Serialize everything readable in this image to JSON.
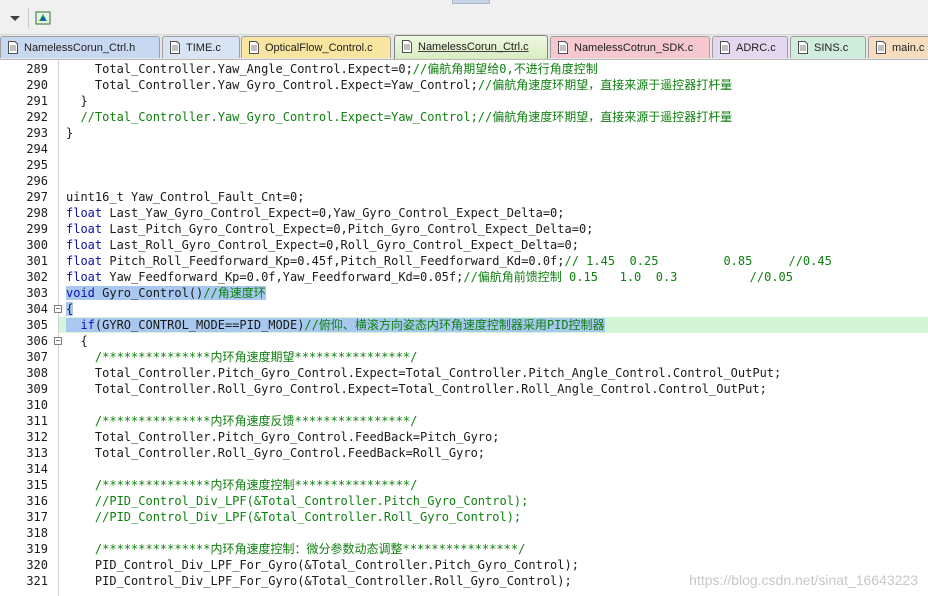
{
  "colors": {
    "keyword": "#1010b0",
    "comment": "#108010",
    "selection": "#a8c8f0",
    "current_line": "#d4f5d8",
    "text": "#1a1a1a"
  },
  "toolbar": {
    "icons": [
      "dropdown-icon",
      "build-icon"
    ]
  },
  "tabs": [
    {
      "label": "NamelessCorun_Ctrl.h",
      "color": "#c8d8f0",
      "active": false
    },
    {
      "label": "TIME.c",
      "color": "#d8e4f4",
      "active": false
    },
    {
      "label": "OpticalFlow_Control.c",
      "color": "#f8e6a0",
      "active": false
    },
    {
      "label": "NamelessCorun_Ctrl.c",
      "color": "#d8ecc0",
      "active": true
    },
    {
      "label": "NamelessCotrun_SDK.c",
      "color": "#f6c8d0",
      "active": false
    },
    {
      "label": "ADRC.c",
      "color": "#e4d8f0",
      "active": false
    },
    {
      "label": "SINS.c",
      "color": "#d0ecdc",
      "active": false
    },
    {
      "label": "main.c",
      "color": "#f8dcc0",
      "active": false
    }
  ],
  "editor": {
    "lines": [
      {
        "num": "289",
        "indent": "    ",
        "text": "Total_Controller.Yaw_Angle_Control.Expect=0;",
        "comment": "//偏航角期望给0,不进行角度控制"
      },
      {
        "num": "290",
        "indent": "    ",
        "text": "Total_Controller.Yaw_Gyro_Control.Expect=Yaw_Control;",
        "comment": "//偏航角速度环期望，直接来源于遥控器打杆量"
      },
      {
        "num": "291",
        "indent": "  ",
        "text": "}",
        "comment": ""
      },
      {
        "num": "292",
        "indent": "  ",
        "text": "",
        "comment": "//Total_Controller.Yaw_Gyro_Control.Expect=Yaw_Control;//偏航角速度环期望，直接来源于遥控器打杆量"
      },
      {
        "num": "293",
        "indent": "",
        "text": "}",
        "comment": ""
      },
      {
        "num": "294",
        "indent": "",
        "text": "",
        "comment": ""
      },
      {
        "num": "295",
        "indent": "",
        "text": "",
        "comment": ""
      },
      {
        "num": "296",
        "indent": "",
        "text": "",
        "comment": ""
      },
      {
        "num": "297",
        "indent": "",
        "text": "uint16_t Yaw_Control_Fault_Cnt=0;",
        "comment": ""
      },
      {
        "num": "298",
        "indent": "",
        "kw": "float",
        "text": " Last_Yaw_Gyro_Control_Expect=0,Yaw_Gyro_Control_Expect_Delta=0;",
        "comment": ""
      },
      {
        "num": "299",
        "indent": "",
        "kw": "float",
        "text": " Last_Pitch_Gyro_Control_Expect=0,Pitch_Gyro_Control_Expect_Delta=0;",
        "comment": ""
      },
      {
        "num": "300",
        "indent": "",
        "kw": "float",
        "text": " Last_Roll_Gyro_Control_Expect=0,Roll_Gyro_Control_Expect_Delta=0;",
        "comment": ""
      },
      {
        "num": "301",
        "indent": "",
        "kw": "float",
        "text": " Pitch_Roll_Feedforward_Kp=0.45f,Pitch_Roll_Feedforward_Kd=0.0f;",
        "comment": "// 1.45  0.25         0.85     //0.45"
      },
      {
        "num": "302",
        "indent": "",
        "kw": "float",
        "text": " Yaw_Feedforward_Kp=0.0f,Yaw_Feedforward_Kd=0.05f;",
        "comment": "//偏航角前馈控制 0.15   1.0  0.3          //0.05"
      },
      {
        "num": "303",
        "indent": "",
        "kw": "void",
        "text": " Gyro_Control()",
        "comment": "//角速度环",
        "selected": true
      },
      {
        "num": "304",
        "indent": "",
        "text": "{",
        "comment": "",
        "selected": true,
        "fold": true
      },
      {
        "num": "305",
        "indent": "  ",
        "kw": "if",
        "text": "(GYRO_CONTROL_MODE==PID_MODE)",
        "comment": "//俯仰、横滚方向姿态内环角速度控制器采用PID控制器",
        "selected": true,
        "current": true
      },
      {
        "num": "306",
        "indent": "  ",
        "text": "{",
        "comment": "",
        "fold": true
      },
      {
        "num": "307",
        "indent": "    ",
        "text": "",
        "comment": "/***************内环角速度期望****************/"
      },
      {
        "num": "308",
        "indent": "    ",
        "text": "Total_Controller.Pitch_Gyro_Control.Expect=Total_Controller.Pitch_Angle_Control.Control_OutPut;",
        "comment": ""
      },
      {
        "num": "309",
        "indent": "    ",
        "text": "Total_Controller.Roll_Gyro_Control.Expect=Total_Controller.Roll_Angle_Control.Control_OutPut;",
        "comment": ""
      },
      {
        "num": "310",
        "indent": "",
        "text": "",
        "comment": ""
      },
      {
        "num": "311",
        "indent": "    ",
        "text": "",
        "comment": "/***************内环角速度反馈****************/"
      },
      {
        "num": "312",
        "indent": "    ",
        "text": "Total_Controller.Pitch_Gyro_Control.FeedBack=Pitch_Gyro;",
        "comment": ""
      },
      {
        "num": "313",
        "indent": "    ",
        "text": "Total_Controller.Roll_Gyro_Control.FeedBack=Roll_Gyro;",
        "comment": ""
      },
      {
        "num": "314",
        "indent": "",
        "text": "",
        "comment": ""
      },
      {
        "num": "315",
        "indent": "    ",
        "text": "",
        "comment": "/***************内环角速度控制****************/"
      },
      {
        "num": "316",
        "indent": "    ",
        "text": "",
        "comment": "//PID_Control_Div_LPF(&Total_Controller.Pitch_Gyro_Control);"
      },
      {
        "num": "317",
        "indent": "    ",
        "text": "",
        "comment": "//PID_Control_Div_LPF(&Total_Controller.Roll_Gyro_Control);"
      },
      {
        "num": "318",
        "indent": "",
        "text": "",
        "comment": ""
      },
      {
        "num": "319",
        "indent": "    ",
        "text": "",
        "comment": "/***************内环角速度控制：微分参数动态调整****************/"
      },
      {
        "num": "320",
        "indent": "    ",
        "text": "PID_Control_Div_LPF_For_Gyro(&Total_Controller.Pitch_Gyro_Control);",
        "comment": ""
      },
      {
        "num": "321",
        "indent": "    ",
        "text": "PID_Control_Div_LPF_For_Gyro(&Total_Controller.Roll_Gyro_Control);",
        "comment": ""
      }
    ]
  },
  "watermark": "https://blog.csdn.net/sinat_16643223"
}
